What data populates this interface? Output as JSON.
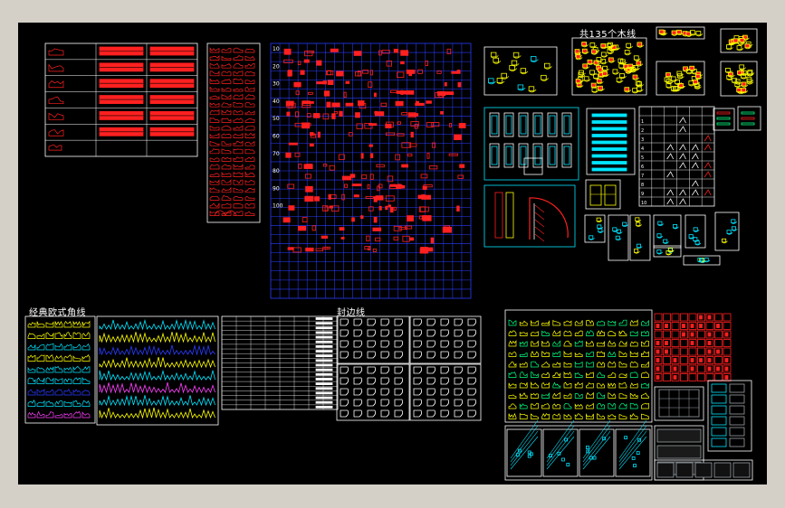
{
  "labels": {
    "moulding_count": "共135个木线",
    "european_corner": "经典欧式角线",
    "edge_banding": "封边线"
  },
  "ruler_numbers": [
    "10",
    "20",
    "30",
    "40",
    "50",
    "60",
    "70",
    "80",
    "90",
    "100"
  ],
  "colors": {
    "background": "#000000",
    "frame": "#d4d0c8",
    "red": "#ff2020",
    "blue": "#2a3cff",
    "cyan": "#00e5ff",
    "yellow": "#ffff00",
    "white": "#ffffff",
    "green": "#00ff80",
    "magenta": "#ff40ff"
  }
}
